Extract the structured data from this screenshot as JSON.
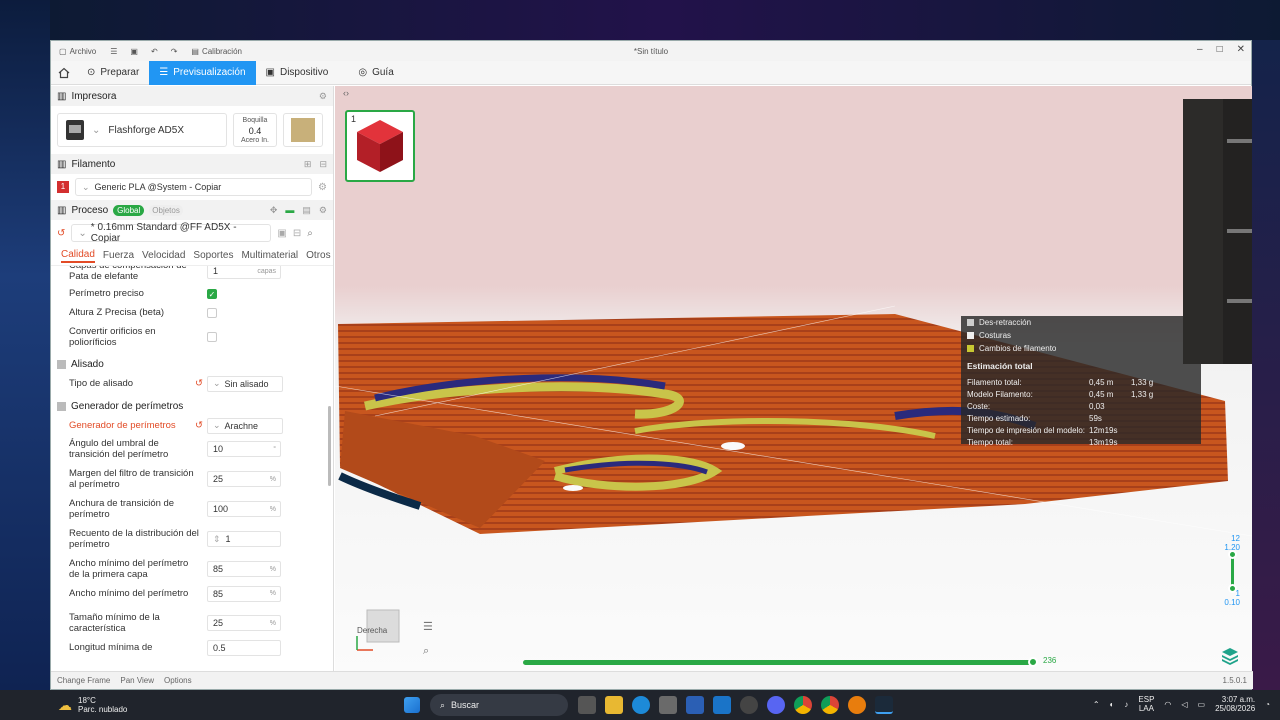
{
  "window": {
    "doc_title": "*Sin título",
    "menu": [
      "Archivo",
      "Calibración"
    ]
  },
  "nav": {
    "tabs": [
      "Preparar",
      "Previsualización",
      "Dispositivo",
      "Guía"
    ],
    "active": "Previsualización"
  },
  "printer": {
    "section": "Impresora",
    "name": "Flashforge AD5X",
    "nozzle_label": "Boquilla",
    "nozzle_value": "0.4",
    "nozzle_material": "Acero In."
  },
  "filament": {
    "section": "Filamento",
    "number": "1",
    "preset": "Generic PLA @System - Copiar"
  },
  "process": {
    "section": "Proceso",
    "global": "Global",
    "objects": "Objetos",
    "preset": "* 0.16mm Standard @FF AD5X - Copiar",
    "tabs": [
      "Calidad",
      "Fuerza",
      "Velocidad",
      "Soportes",
      "Multimaterial",
      "Otros"
    ]
  },
  "settings": {
    "elephant_label": "Capas de compensación de Pata de elefante",
    "elephant_value": "1",
    "elephant_unit": "capas",
    "precise_wall": "Perímetro preciso",
    "precise_z": "Altura Z Precisa (beta)",
    "convert_holes": "Convertir orificios en polioríficios",
    "ironing_group": "Alisado",
    "ironing_type_label": "Tipo de alisado",
    "ironing_type_value": "Sin alisado",
    "wall_gen_group": "Generador de perímetros",
    "wall_gen_label": "Generador de perímetros",
    "wall_gen_value": "Arachne",
    "angle_label": "Ángulo del umbral de transición del perímetro",
    "angle_value": "10",
    "angle_unit": "°",
    "filter_label": "Margen del filtro de transición al perímetro",
    "filter_value": "25",
    "filter_unit": "%",
    "trans_width_label": "Anchura de transición de perímetro",
    "trans_width_value": "100",
    "trans_width_unit": "%",
    "dist_count_label": "Recuento de la distribución del perímetro",
    "dist_count_value": "1",
    "min_first_label": "Ancho mínimo del perímetro de la primera capa",
    "min_first_value": "85",
    "min_first_unit": "%",
    "min_wall_label": "Ancho mínimo del perímetro",
    "min_wall_value": "85",
    "min_wall_unit": "%",
    "min_feature_label": "Tamaño mínimo de la característica",
    "min_feature_value": "25",
    "min_feature_unit": "%",
    "min_length_label": "Longitud mínima de",
    "min_length_value": "0.5"
  },
  "plate": {
    "number": "1"
  },
  "legend": {
    "items": [
      {
        "name": "Des-retracción",
        "color": "#cccccc"
      },
      {
        "name": "Costuras",
        "color": "#eeeeee"
      },
      {
        "name": "Cambios de filamento",
        "color": "#c8c832"
      }
    ],
    "estimation_title": "Estimación total",
    "rows": [
      {
        "k": "Filamento total:",
        "v1": "0,45 m",
        "v2": "1,33 g"
      },
      {
        "k": "Modelo Filamento:",
        "v1": "0,45 m",
        "v2": "1,33 g"
      },
      {
        "k": "Coste:",
        "v1": "0,03",
        "v2": ""
      },
      {
        "k": "Tiempo estimado:",
        "v1": "59s",
        "v2": ""
      },
      {
        "k": "Tiempo de impresión del modelo:",
        "v1": "12m19s",
        "v2": ""
      },
      {
        "k": "Tiempo total:",
        "v1": "13m19s",
        "v2": ""
      }
    ]
  },
  "viewport": {
    "navcube_label": "Derecha",
    "layer_top": "12",
    "layer_top_height": "1.20",
    "layer_bottom": "1",
    "layer_bottom_height": "0.10",
    "move_value": "236"
  },
  "statusbar": {
    "items": [
      "Change Frame",
      "Pan View",
      "Options"
    ],
    "version": "1.5.0.1"
  },
  "taskbar": {
    "temp": "18°C",
    "weather": "Parc. nublado",
    "search": "Buscar",
    "lang1": "ESP",
    "lang2": "LAA",
    "time": "3:07 a.m.",
    "date": "25/08/2026"
  },
  "colors": {
    "accent": "#2196f3",
    "green": "#2aa845",
    "orange": "#e24b26",
    "print": "#c8561e"
  }
}
